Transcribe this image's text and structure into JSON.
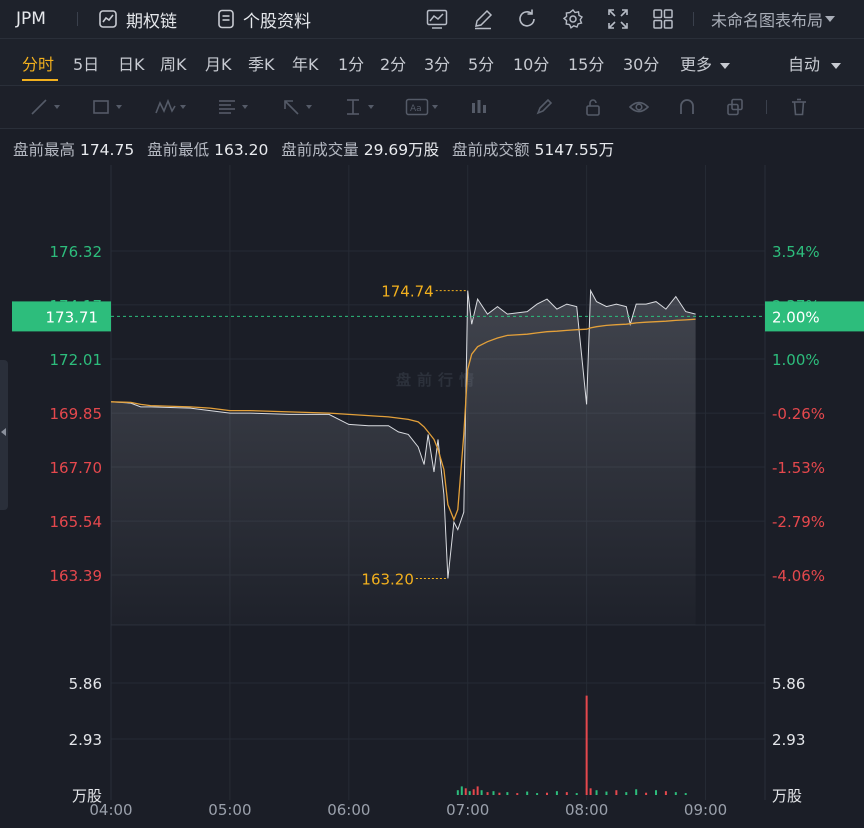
{
  "topbar": {
    "symbol": "JPM",
    "options_chain": "期权链",
    "stock_profile": "个股资料",
    "layout_name": "未命名图表布局"
  },
  "periods": [
    "分时",
    "5日",
    "日K",
    "周K",
    "月K",
    "季K",
    "年K",
    "1分",
    "2分",
    "3分",
    "5分",
    "10分",
    "15分",
    "30分",
    "更多"
  ],
  "active_period": "分时",
  "auto_label": "自动",
  "stats": {
    "high_label": "盘前最高",
    "high_value": "174.75",
    "low_label": "盘前最低",
    "low_value": "163.20",
    "volume_label": "盘前成交量",
    "volume_value": "29.69万股",
    "amount_label": "盘前成交额",
    "amount_value": "5147.55万"
  },
  "watermark": "盘前行情",
  "price_axis_left": [
    "176.32",
    "174.17",
    "172.01",
    "169.85",
    "167.70",
    "165.54",
    "163.39"
  ],
  "price_axis_right": [
    "3.54%",
    "2.37%",
    "1.00%",
    "-0.26%",
    "-1.53%",
    "-2.79%",
    "-4.06%"
  ],
  "current_price": "173.71",
  "current_change": "2.00%",
  "high_marker": "174.74",
  "low_marker": "163.20",
  "volume_axis": [
    "5.86",
    "2.93"
  ],
  "volume_unit": "万股",
  "time_axis": [
    "04:00",
    "05:00",
    "06:00",
    "07:00",
    "08:00",
    "09:00"
  ],
  "colors": {
    "up": "#2dbd7c",
    "down": "#e5484d",
    "accent": "#f2b01e",
    "price_line": "#d9dbe0",
    "avg_line": "#e3a03a"
  },
  "chart_data": {
    "type": "line",
    "x_unit": "time",
    "x": [
      "04:00",
      "04:10",
      "04:15",
      "04:20",
      "04:40",
      "04:50",
      "05:00",
      "05:10",
      "05:30",
      "05:50",
      "06:00",
      "06:10",
      "06:20",
      "06:25",
      "06:30",
      "06:35",
      "06:38",
      "06:40",
      "06:43",
      "06:45",
      "06:48",
      "06:50",
      "06:53",
      "06:55",
      "06:58",
      "07:00",
      "07:02",
      "07:05",
      "07:10",
      "07:15",
      "07:20",
      "07:30",
      "07:35",
      "07:40",
      "07:45",
      "07:50",
      "07:55",
      "08:00",
      "08:02",
      "08:05",
      "08:10",
      "08:15",
      "08:20",
      "08:22",
      "08:25",
      "08:30",
      "08:35",
      "08:40",
      "08:45",
      "08:50",
      "08:55"
    ],
    "series": [
      {
        "values": [
          170.3,
          170.25,
          170.1,
          170.1,
          170.05,
          169.95,
          169.85,
          169.85,
          169.8,
          169.8,
          169.4,
          169.35,
          169.35,
          169.1,
          169.0,
          168.5,
          167.8,
          169.0,
          167.5,
          168.8,
          166.6,
          163.25,
          165.5,
          165.2,
          165.9,
          174.74,
          173.4,
          174.4,
          173.8,
          174.1,
          173.8,
          173.9,
          174.2,
          174.4,
          174.0,
          174.2,
          174.1,
          170.2,
          174.74,
          174.3,
          174.1,
          174.2,
          174.1,
          173.4,
          174.2,
          174.2,
          174.3,
          174.0,
          174.5,
          173.9,
          173.8
        ]
      },
      {
        "values": [
          170.3,
          170.28,
          170.2,
          170.15,
          170.1,
          170.05,
          169.95,
          169.95,
          169.9,
          169.85,
          169.8,
          169.75,
          169.7,
          169.65,
          169.6,
          169.5,
          169.3,
          169.1,
          168.8,
          168.4,
          167.6,
          166.2,
          165.6,
          166.0,
          169.0,
          171.6,
          172.2,
          172.5,
          172.7,
          172.85,
          172.95,
          173.0,
          173.05,
          173.1,
          173.12,
          173.15,
          173.18,
          173.2,
          173.25,
          173.3,
          173.35,
          173.38,
          173.4,
          173.42,
          173.45,
          173.48,
          173.5,
          173.52,
          173.55,
          173.57,
          173.6
        ]
      }
    ],
    "ylim": [
      163.39,
      176.32
    ],
    "yticks": [
      176.32,
      174.17,
      172.01,
      169.85,
      167.7,
      165.54,
      163.39
    ],
    "volume_ylim": [
      0,
      5.86
    ],
    "volume": [
      {
        "t": "06:55",
        "v": 0.25,
        "d": "up"
      },
      {
        "t": "06:57",
        "v": 0.45,
        "d": "up"
      },
      {
        "t": "06:59",
        "v": 0.35,
        "d": "down"
      },
      {
        "t": "07:01",
        "v": 0.2,
        "d": "up"
      },
      {
        "t": "07:03",
        "v": 0.3,
        "d": "down"
      },
      {
        "t": "07:05",
        "v": 0.45,
        "d": "down"
      },
      {
        "t": "07:07",
        "v": 0.25,
        "d": "up"
      },
      {
        "t": "07:10",
        "v": 0.15,
        "d": "down"
      },
      {
        "t": "07:13",
        "v": 0.2,
        "d": "up"
      },
      {
        "t": "07:16",
        "v": 0.12,
        "d": "down"
      },
      {
        "t": "07:20",
        "v": 0.15,
        "d": "up"
      },
      {
        "t": "07:25",
        "v": 0.1,
        "d": "down"
      },
      {
        "t": "07:30",
        "v": 0.18,
        "d": "up"
      },
      {
        "t": "07:35",
        "v": 0.1,
        "d": "up"
      },
      {
        "t": "07:40",
        "v": 0.12,
        "d": "down"
      },
      {
        "t": "07:45",
        "v": 0.2,
        "d": "up"
      },
      {
        "t": "07:50",
        "v": 0.15,
        "d": "down"
      },
      {
        "t": "07:55",
        "v": 0.1,
        "d": "up"
      },
      {
        "t": "08:00",
        "v": 5.2,
        "d": "down"
      },
      {
        "t": "08:02",
        "v": 0.35,
        "d": "down"
      },
      {
        "t": "08:05",
        "v": 0.25,
        "d": "up"
      },
      {
        "t": "08:10",
        "v": 0.18,
        "d": "up"
      },
      {
        "t": "08:15",
        "v": 0.25,
        "d": "down"
      },
      {
        "t": "08:20",
        "v": 0.15,
        "d": "up"
      },
      {
        "t": "08:25",
        "v": 0.3,
        "d": "up"
      },
      {
        "t": "08:30",
        "v": 0.12,
        "d": "down"
      },
      {
        "t": "08:35",
        "v": 0.25,
        "d": "up"
      },
      {
        "t": "08:40",
        "v": 0.2,
        "d": "down"
      },
      {
        "t": "08:45",
        "v": 0.15,
        "d": "up"
      },
      {
        "t": "08:50",
        "v": 0.1,
        "d": "up"
      }
    ]
  }
}
